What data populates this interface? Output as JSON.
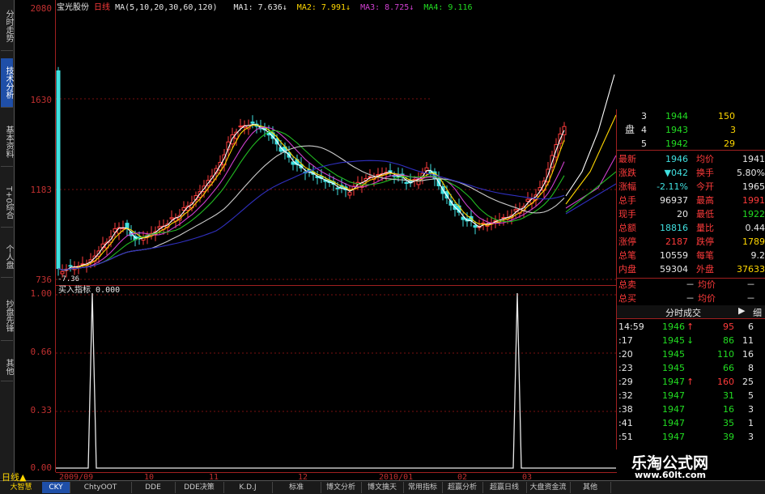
{
  "side_tabs": [
    {
      "label": "分时走势",
      "active": false
    },
    {
      "label": "技术分析",
      "active": true
    },
    {
      "label": "基本资料",
      "active": false
    },
    {
      "label": "T+0综合",
      "active": false
    },
    {
      "label": "个人盘",
      "active": false
    },
    {
      "label": "抄盘先锋",
      "active": false
    },
    {
      "label": "其他",
      "active": false
    }
  ],
  "header": {
    "stock_name": "宝光股份",
    "period": "日线",
    "ma_label": "MA(5,10,20,30,60,120)",
    "ma1": "MA1: 7.636↓",
    "ma2": "MA2: 7.991↓",
    "ma3": "MA3: 8.725↓",
    "ma4": "MA4: 9.116"
  },
  "price_axis": [
    "2080",
    "1630",
    "1183",
    "736"
  ],
  "price_low_label": "-7.36",
  "indicator": {
    "label": "买入指标",
    "value": "0.000",
    "axis": [
      "1.00",
      "0.66",
      "0.33",
      "0.00"
    ]
  },
  "x_axis": [
    "2009/09",
    "10",
    "11",
    "12",
    "2010/01",
    "02",
    "03"
  ],
  "order_book": [
    {
      "n": "3",
      "p": "1944",
      "v": "150"
    },
    {
      "n": "4",
      "p": "1943",
      "v": "3"
    },
    {
      "n": "5",
      "p": "1942",
      "v": "29"
    }
  ],
  "book_label": "盘",
  "quote": [
    {
      "k1": "最新",
      "v1": "1946",
      "k2": "均价",
      "v2": "1941"
    },
    {
      "k1": "涨跌",
      "v1": "▼042",
      "k2": "换手",
      "v2": "5.80%"
    },
    {
      "k1": "涨幅",
      "v1": "-2.11%",
      "k2": "今开",
      "v2": "1965"
    },
    {
      "k1": "总手",
      "v1": "96937",
      "k2": "最高",
      "v2": "1991"
    },
    {
      "k1": "现手",
      "v1": "20",
      "k2": "最低",
      "v2": "1922"
    },
    {
      "k1": "总额",
      "v1": "18816",
      "k2": "量比",
      "v2": "0.44"
    },
    {
      "k1": "涨停",
      "v1": "2187",
      "k2": "跌停",
      "v2": "1789"
    },
    {
      "k1": "总笔",
      "v1": "10559",
      "k2": "每笔",
      "v2": "9.2"
    },
    {
      "k1": "内盘",
      "v1": "59304",
      "k2": "外盘",
      "v2": "37633"
    }
  ],
  "summary": [
    {
      "k": "总卖",
      "v": "－",
      "k2": "均价",
      "v2": "－"
    },
    {
      "k": "总买",
      "v": "－",
      "k2": "均价",
      "v2": "－"
    }
  ],
  "ticks_title": "分时成交",
  "ticks_btn": "细",
  "ticks": [
    {
      "t": "14:59",
      "p": "1946",
      "a": "↑",
      "v": "95",
      "n": "6"
    },
    {
      "t": ":17",
      "p": "1945",
      "a": "↓",
      "v": "86",
      "n": "11"
    },
    {
      "t": ":20",
      "p": "1945",
      "a": "",
      "v": "110",
      "n": "16"
    },
    {
      "t": ":23",
      "p": "1945",
      "a": "",
      "v": "66",
      "n": "8"
    },
    {
      "t": ":29",
      "p": "1947",
      "a": "↑",
      "v": "160",
      "n": "25"
    },
    {
      "t": ":32",
      "p": "1947",
      "a": "",
      "v": "31",
      "n": "5"
    },
    {
      "t": ":38",
      "p": "1947",
      "a": "",
      "v": "16",
      "n": "3"
    },
    {
      "t": ":41",
      "p": "1947",
      "a": "",
      "v": "35",
      "n": "1"
    },
    {
      "t": ":51",
      "p": "1947",
      "a": "",
      "v": "39",
      "n": "3"
    }
  ],
  "bottom_tabs": [
    "日线",
    "大智慧",
    "CKY",
    "ChtyOOT",
    "DDE",
    "DDE决策",
    "K.D.J",
    "标准",
    "博文分析",
    "博文擒天",
    "常用指标",
    "超赢分析",
    "超赢日线",
    "大盘资金流",
    "其他"
  ],
  "watermark": {
    "title": "乐淘公式网",
    "url": "www.60lt.com"
  },
  "colors": {
    "up": "#ff3b3b",
    "down": "#40e0e0",
    "axis": "#c03030"
  }
}
